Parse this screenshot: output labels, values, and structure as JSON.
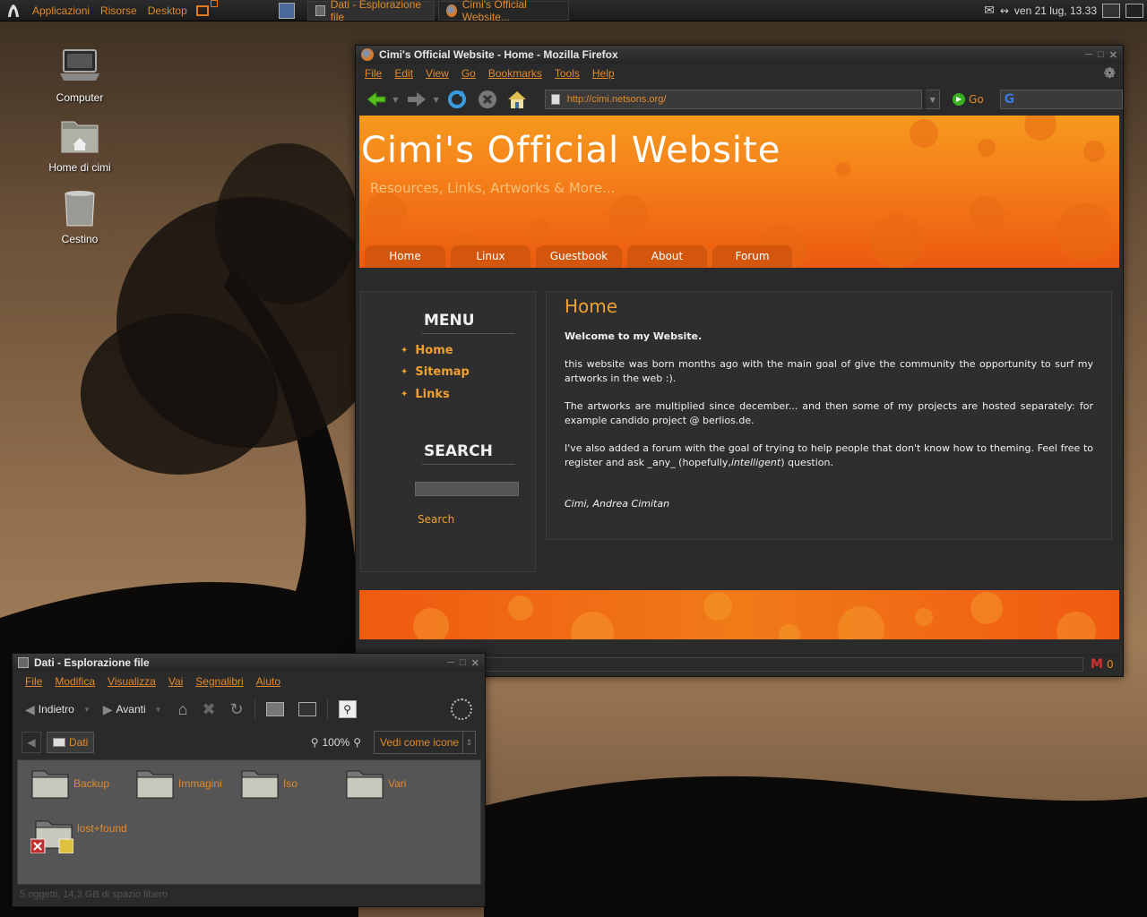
{
  "top_panel": {
    "menus": [
      "Applicazioni",
      "Risorse",
      "Desktop"
    ],
    "tasks": [
      {
        "label": "Dati - Esplorazione file"
      },
      {
        "label": "Cimi's Official Website..."
      }
    ],
    "clock": "ven 21 lug, 13.33"
  },
  "desktop_icons": [
    {
      "label": "Computer",
      "icon": "computer-icon"
    },
    {
      "label": "Home di cimi",
      "icon": "home-folder-icon"
    },
    {
      "label": "Cestino",
      "icon": "trash-icon"
    }
  ],
  "firefox": {
    "title": "Cimi's Official Website - Home - Mozilla Firefox",
    "menus": [
      "File",
      "Edit",
      "View",
      "Go",
      "Bookmarks",
      "Tools",
      "Help"
    ],
    "url": "http://cimi.netsons.org/",
    "go_label": "Go",
    "gmail_count": "0",
    "site": {
      "title": "Cimi's Official Website",
      "subtitle": "Resources, Links, Artworks & More...",
      "nav": [
        "Home",
        "Linux",
        "Guestbook",
        "About",
        "Forum"
      ],
      "menu_heading": "MENU",
      "menu_links": [
        "Home",
        "Sitemap",
        "Links"
      ],
      "search_heading": "SEARCH",
      "search_button": "Search",
      "page_heading": "Home",
      "welcome": "Welcome to my Website.",
      "para1": "this website was born months ago with the main goal of give the community the opportunity to surf my artworks in the web :).",
      "para2": "The artworks are multiplied since december... and then some of my projects are hosted separately: for example candido project @ berlios.de.",
      "para3_a": "I've also added a forum with the goal of trying to help people that don't know how to theming. Feel free to register and ask _any_ (hopefully,",
      "para3_em": "intelligent",
      "para3_b": ") question.",
      "signature": "Cimi, Andrea Cimitan"
    }
  },
  "file_manager": {
    "title": "Dati - Esplorazione file",
    "menus": [
      "File",
      "Modifica",
      "Visualizza",
      "Vai",
      "Segnalibri",
      "Aiuto"
    ],
    "back_label": "Indietro",
    "forward_label": "Avanti",
    "location": "Dati",
    "zoom": "100%",
    "view_mode": "Vedi come icone",
    "items": [
      "Backup",
      "Immagini",
      "Iso",
      "Vari",
      "lost+found"
    ],
    "status": "5 oggetti, 14,3 GB di spazio libero"
  },
  "colors": {
    "accent": "#e08a2c",
    "header_orange": "#f5801a",
    "panel_dark": "#2a2a2a"
  }
}
